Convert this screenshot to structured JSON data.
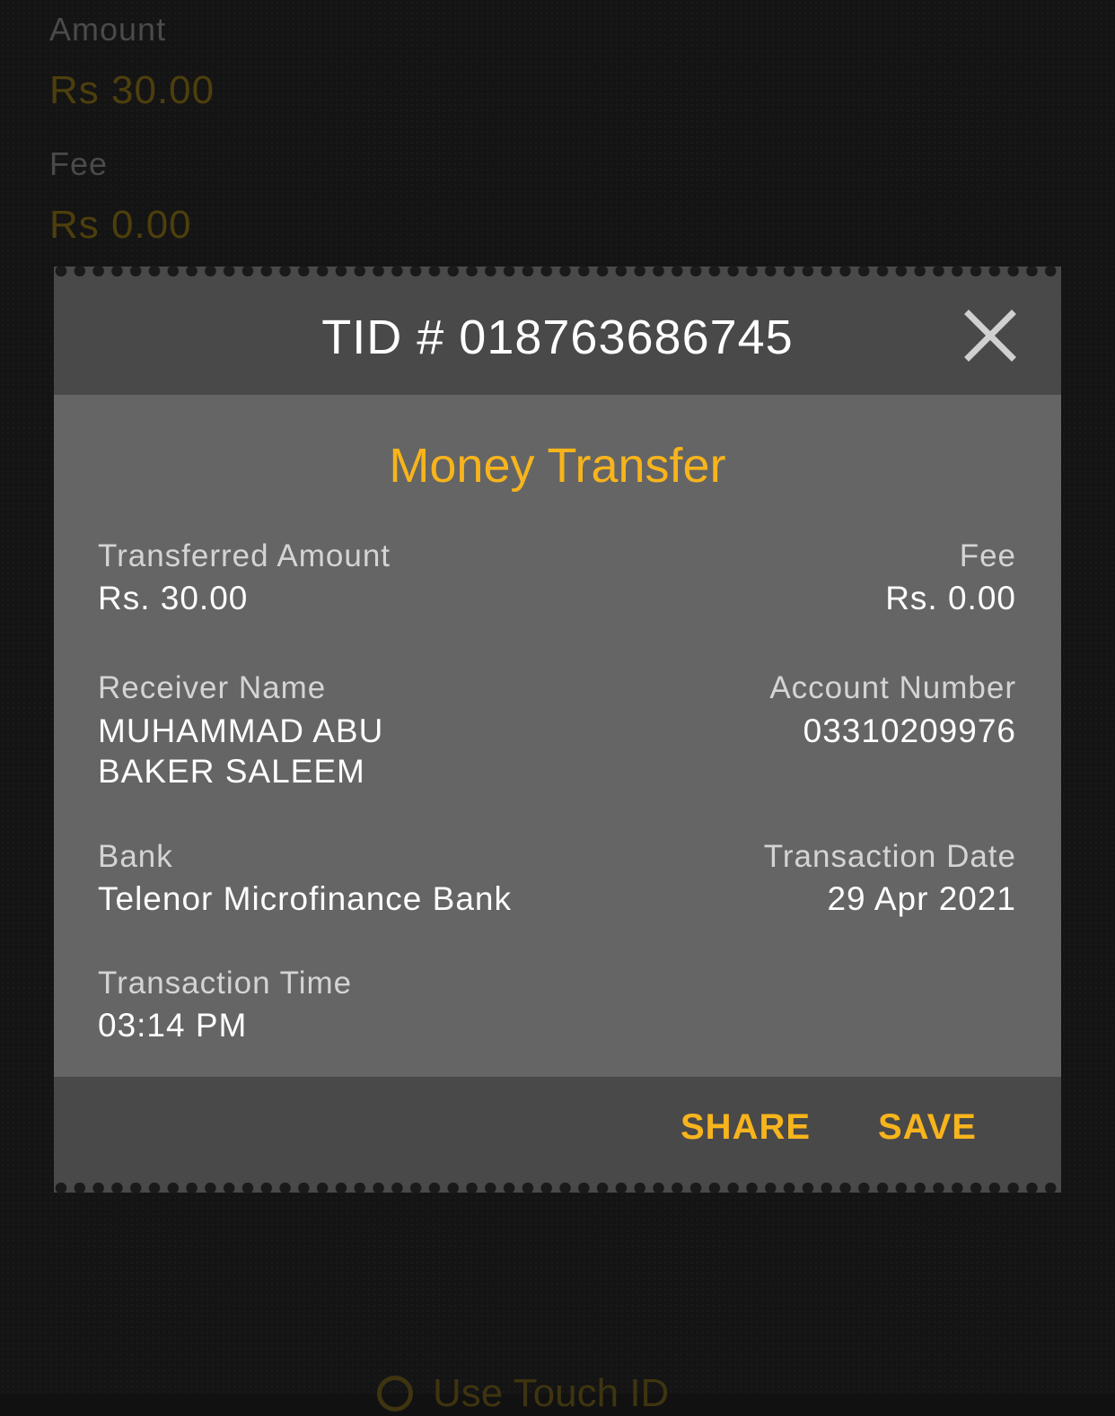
{
  "background": {
    "amount_label": "Amount",
    "amount_value": "Rs 30.00",
    "fee_label": "Fee",
    "fee_value": "Rs 0.00",
    "touch_id_label": "Use Touch ID"
  },
  "receipt": {
    "tid": "TID # 018763686745",
    "title": "Money Transfer",
    "fields": {
      "transferred_amount_label": "Transferred Amount",
      "transferred_amount_value": "Rs. 30.00",
      "fee_label": "Fee",
      "fee_value": "Rs. 0.00",
      "receiver_name_label": "Receiver Name",
      "receiver_name_line1": "MUHAMMAD ABU",
      "receiver_name_line2": "BAKER SALEEM",
      "account_number_label": "Account Number",
      "account_number_value": "03310209976",
      "bank_label": "Bank",
      "bank_value": "Telenor Microfinance Bank",
      "transaction_date_label": "Transaction Date",
      "transaction_date_value": "29 Apr 2021",
      "transaction_time_label": "Transaction Time",
      "transaction_time_value": "03:14 PM"
    },
    "actions": {
      "share_label": "SHARE",
      "save_label": "SAVE"
    }
  },
  "colors": {
    "accent": "#f7b41c",
    "header_bg": "#4a4949",
    "body_bg": "#656565",
    "overlay_bg": "#141414"
  },
  "icons": {
    "close": "close-icon",
    "touch_id": "fingerprint-icon"
  }
}
